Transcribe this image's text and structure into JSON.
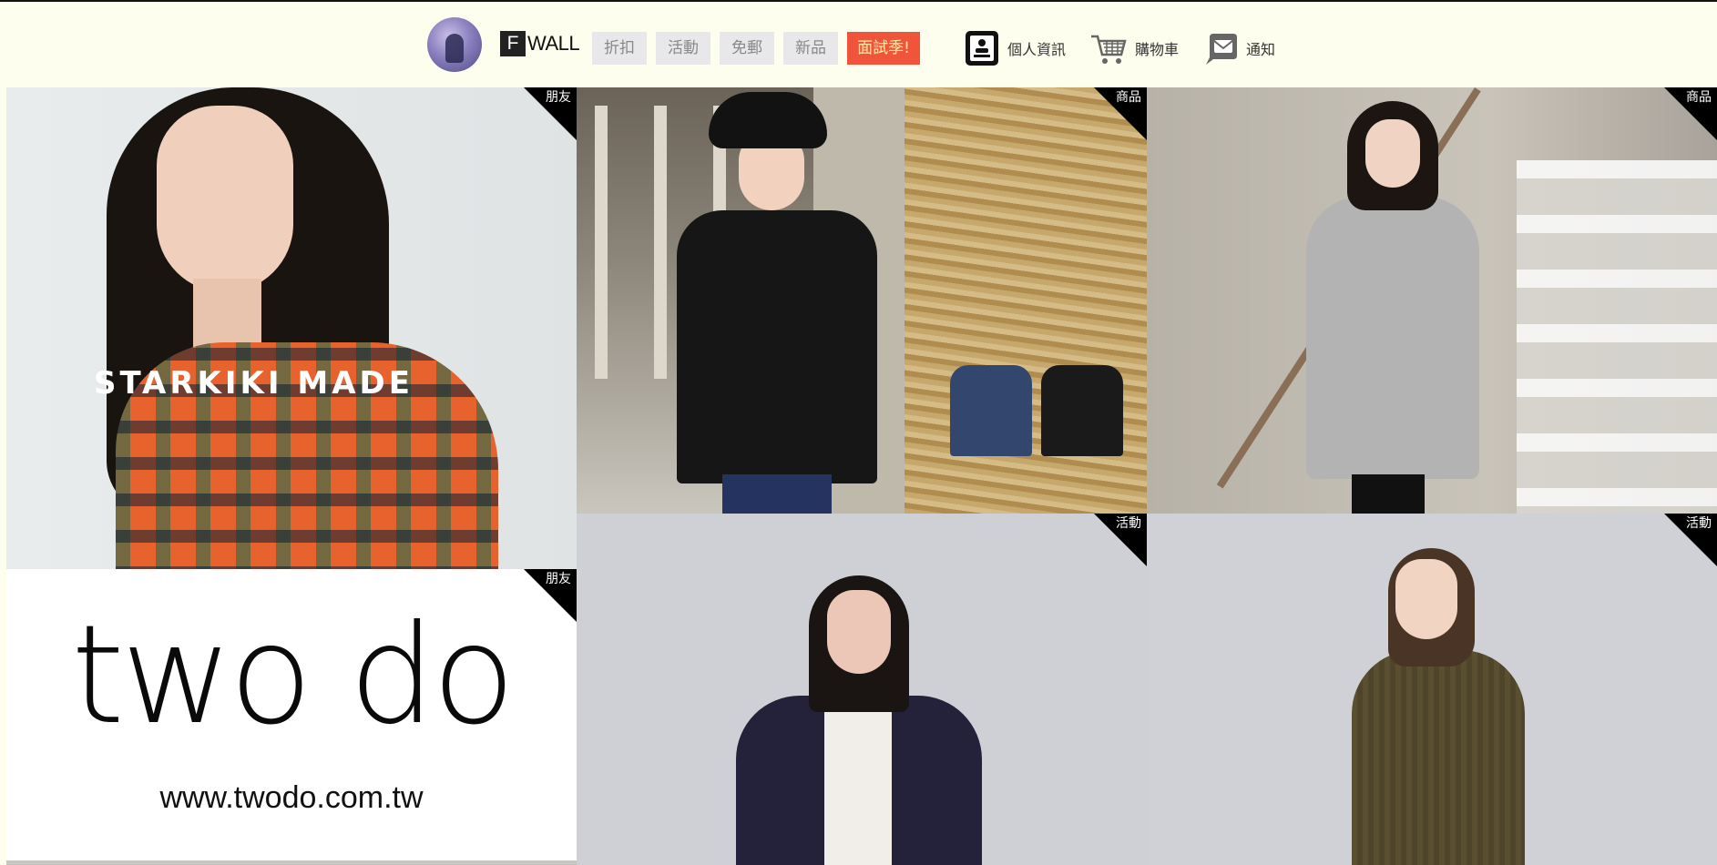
{
  "header": {
    "logo_letter": "F",
    "logo_text": "WALL",
    "nav": [
      "折扣",
      "活動",
      "免郵",
      "新品"
    ],
    "promo_label": "面試季!",
    "tools": {
      "profile_label": "個人資訊",
      "cart_label": "購物車",
      "notify_label": "通知"
    }
  },
  "tiles": [
    {
      "tag": "朋友",
      "overlay_text": "STARKIKI MADE"
    },
    {
      "tag": "商品"
    },
    {
      "tag": "商品"
    },
    {
      "tag": "朋友",
      "brand": "two do",
      "url": "www.twodo.com.tw"
    },
    {
      "tag": "活動"
    },
    {
      "tag": "活動"
    }
  ],
  "colors": {
    "page_bg": "#fefeee",
    "promo_bg": "#f0543a",
    "promo_text": "#fff3a0",
    "nav_bg": "#e8e8ea",
    "tag_bg": "#000000"
  }
}
